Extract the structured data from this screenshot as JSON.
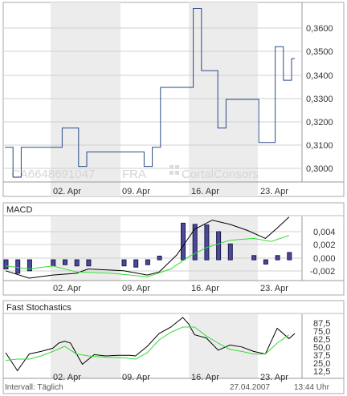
{
  "chart_data": [
    {
      "type": "line",
      "title": "",
      "x": [
        "02. Apr",
        "09. Apr",
        "16. Apr",
        "23. Apr"
      ],
      "ylim": [
        0.2955,
        0.3705
      ],
      "yticks": [
        "0,3000",
        "0,3100",
        "0,3200",
        "0,3300",
        "0,3400",
        "0,3500",
        "0,3600"
      ],
      "shaded_weeks": [
        "02. Apr",
        "16. Apr"
      ],
      "step_series": [
        {
          "d": 0,
          "v": 0.31
        },
        {
          "d": 1,
          "v": 0.2975
        },
        {
          "d": 2,
          "v": 0.31
        },
        {
          "d": 3,
          "v": 0.31
        },
        {
          "d": 4,
          "v": 0.31
        },
        {
          "d": 5,
          "v": 0.31
        },
        {
          "d": 6,
          "v": 0.31
        },
        {
          "d": 7,
          "v": 0.318
        },
        {
          "d": 8,
          "v": 0.318
        },
        {
          "d": 9,
          "v": 0.302
        },
        {
          "d": 10,
          "v": 0.308
        },
        {
          "d": 11,
          "v": 0.308
        },
        {
          "d": 12,
          "v": 0.308
        },
        {
          "d": 13,
          "v": 0.308
        },
        {
          "d": 14,
          "v": 0.308
        },
        {
          "d": 15,
          "v": 0.308
        },
        {
          "d": 16,
          "v": 0.308
        },
        {
          "d": 17,
          "v": 0.302
        },
        {
          "d": 18,
          "v": 0.31
        },
        {
          "d": 19,
          "v": 0.335
        },
        {
          "d": 20,
          "v": 0.335
        },
        {
          "d": 21,
          "v": 0.335
        },
        {
          "d": 22,
          "v": 0.335
        },
        {
          "d": 23,
          "v": 0.368
        },
        {
          "d": 24,
          "v": 0.342
        },
        {
          "d": 25,
          "v": 0.342
        },
        {
          "d": 26,
          "v": 0.318
        },
        {
          "d": 27,
          "v": 0.33
        },
        {
          "d": 28,
          "v": 0.33
        },
        {
          "d": 29,
          "v": 0.33
        },
        {
          "d": 30,
          "v": 0.33
        },
        {
          "d": 31,
          "v": 0.312
        },
        {
          "d": 32,
          "v": 0.312
        },
        {
          "d": 33,
          "v": 0.352
        },
        {
          "d": 34,
          "v": 0.338
        },
        {
          "d": 35,
          "v": 0.347
        }
      ]
    },
    {
      "type": "bar",
      "title": "MACD",
      "x": [
        "02. Apr",
        "09. Apr",
        "16. Apr",
        "23. Apr"
      ],
      "ylim": [
        -0.0034,
        0.0071
      ],
      "yticks": [
        "0,004",
        "0,002",
        "0,000",
        "-0,002"
      ],
      "histogram": [
        {
          "d": 0,
          "v": -0.0015
        },
        {
          "d": 2,
          "v": -0.0022
        },
        {
          "d": 4,
          "v": -0.0018
        },
        {
          "d": 8,
          "v": -0.001
        },
        {
          "d": 10,
          "v": -0.0008
        },
        {
          "d": 12,
          "v": -0.001
        },
        {
          "d": 14,
          "v": -0.001
        },
        {
          "d": 20,
          "v": -0.001
        },
        {
          "d": 22,
          "v": -0.0012
        },
        {
          "d": 24,
          "v": -0.0008
        },
        {
          "d": 26,
          "v": 0.0006
        },
        {
          "d": 30,
          "v": 0.006
        },
        {
          "d": 32,
          "v": 0.0058
        },
        {
          "d": 34,
          "v": 0.0057
        },
        {
          "d": 36,
          "v": 0.0046
        },
        {
          "d": 38,
          "v": 0.0026
        },
        {
          "d": 42,
          "v": 0.0007
        },
        {
          "d": 44,
          "v": -0.0007
        },
        {
          "d": 46,
          "v": 0.0007
        },
        {
          "d": 48,
          "v": 0.0012
        }
      ],
      "series": [
        {
          "color": "#000000",
          "values": [
            {
              "d": 0,
              "v": -0.0018
            },
            {
              "d": 4,
              "v": -0.003
            },
            {
              "d": 8,
              "v": -0.0025
            },
            {
              "d": 12,
              "v": -0.0022
            },
            {
              "d": 14,
              "v": -0.0015
            },
            {
              "d": 20,
              "v": -0.0018
            },
            {
              "d": 24,
              "v": -0.0025
            },
            {
              "d": 26,
              "v": -0.002
            },
            {
              "d": 29,
              "v": 0.0008
            },
            {
              "d": 32,
              "v": 0.005
            },
            {
              "d": 35,
              "v": 0.0065
            },
            {
              "d": 38,
              "v": 0.0058
            },
            {
              "d": 41,
              "v": 0.0048
            },
            {
              "d": 44,
              "v": 0.0035
            },
            {
              "d": 46,
              "v": 0.0052
            },
            {
              "d": 48,
              "v": 0.007
            }
          ]
        },
        {
          "color": "#33dd33",
          "values": [
            {
              "d": 0,
              "v": -0.001
            },
            {
              "d": 4,
              "v": -0.0015
            },
            {
              "d": 8,
              "v": -0.001
            },
            {
              "d": 12,
              "v": -0.002
            },
            {
              "d": 18,
              "v": -0.0022
            },
            {
              "d": 24,
              "v": -0.0028
            },
            {
              "d": 28,
              "v": -0.0015
            },
            {
              "d": 31,
              "v": 0.0005
            },
            {
              "d": 34,
              "v": 0.002
            },
            {
              "d": 38,
              "v": 0.0032
            },
            {
              "d": 42,
              "v": 0.0035
            },
            {
              "d": 45,
              "v": 0.003
            },
            {
              "d": 48,
              "v": 0.004
            }
          ]
        }
      ]
    },
    {
      "type": "line",
      "title": "Fast Stochastics",
      "x": [
        "02. Apr",
        "09. Apr",
        "16. Apr",
        "23. Apr"
      ],
      "ylim": [
        0,
        100
      ],
      "yticks": [
        "87,5",
        "75,0",
        "62,5",
        "50,0",
        "37,5",
        "25,0",
        "12,5"
      ],
      "series": [
        {
          "color": "#000000",
          "values": [
            {
              "d": 0,
              "v": 40
            },
            {
              "d": 2,
              "v": 12
            },
            {
              "d": 4,
              "v": 38
            },
            {
              "d": 6,
              "v": 42
            },
            {
              "d": 8,
              "v": 47
            },
            {
              "d": 9,
              "v": 55
            },
            {
              "d": 10,
              "v": 58
            },
            {
              "d": 11,
              "v": 55
            },
            {
              "d": 13,
              "v": 22
            },
            {
              "d": 15,
              "v": 37
            },
            {
              "d": 17,
              "v": 35
            },
            {
              "d": 19,
              "v": 36
            },
            {
              "d": 21,
              "v": 36
            },
            {
              "d": 22,
              "v": 35
            },
            {
              "d": 24,
              "v": 50
            },
            {
              "d": 26,
              "v": 70
            },
            {
              "d": 28,
              "v": 80
            },
            {
              "d": 30,
              "v": 95
            },
            {
              "d": 31,
              "v": 85
            },
            {
              "d": 32,
              "v": 68
            },
            {
              "d": 34,
              "v": 63
            },
            {
              "d": 36,
              "v": 44
            },
            {
              "d": 38,
              "v": 52
            },
            {
              "d": 40,
              "v": 49
            },
            {
              "d": 42,
              "v": 42
            },
            {
              "d": 44,
              "v": 38
            },
            {
              "d": 46,
              "v": 78
            },
            {
              "d": 48,
              "v": 62
            },
            {
              "d": 49,
              "v": 70
            }
          ]
        },
        {
          "color": "#33dd33",
          "values": [
            {
              "d": 0,
              "v": 28
            },
            {
              "d": 2,
              "v": 30
            },
            {
              "d": 4,
              "v": 30
            },
            {
              "d": 6,
              "v": 35
            },
            {
              "d": 8,
              "v": 42
            },
            {
              "d": 10,
              "v": 50
            },
            {
              "d": 12,
              "v": 38
            },
            {
              "d": 14,
              "v": 35
            },
            {
              "d": 17,
              "v": 33
            },
            {
              "d": 20,
              "v": 32
            },
            {
              "d": 22,
              "v": 30
            },
            {
              "d": 24,
              "v": 40
            },
            {
              "d": 26,
              "v": 60
            },
            {
              "d": 28,
              "v": 72
            },
            {
              "d": 30,
              "v": 80
            },
            {
              "d": 32,
              "v": 80
            },
            {
              "d": 34,
              "v": 66
            },
            {
              "d": 36,
              "v": 55
            },
            {
              "d": 38,
              "v": 45
            },
            {
              "d": 40,
              "v": 42
            },
            {
              "d": 42,
              "v": 38
            },
            {
              "d": 44,
              "v": 38
            },
            {
              "d": 46,
              "v": 55
            },
            {
              "d": 48,
              "v": 68
            }
          ]
        }
      ]
    }
  ],
  "watermark": {
    "isin": "CA6648691047",
    "exchange": "FRA",
    "brand": "CortalConsors"
  },
  "footer": {
    "interval": "Intervall: Täglich",
    "date": "27.04.2007",
    "time": "13:44 Uhr"
  },
  "colors": {
    "price_line": "#2a4a8a",
    "shade": "#ececec",
    "grid": "#c8c8c8",
    "hist_fill": "#4a4a9a",
    "hist_stroke": "#1a1a4a"
  }
}
